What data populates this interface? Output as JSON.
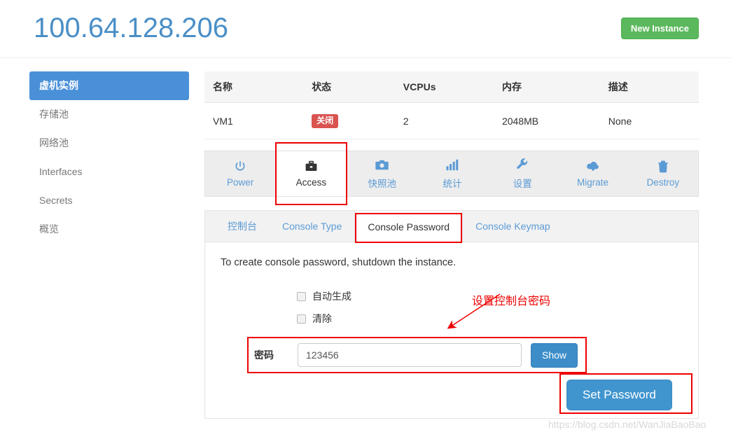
{
  "header": {
    "title": "100.64.128.206",
    "new_instance_label": "New Instance",
    "new_instance_color": "#5cb85c",
    "title_color": "#4a8fc7"
  },
  "sidebar": {
    "items": [
      {
        "label": "虚机实例",
        "active": true
      },
      {
        "label": "存储池",
        "active": false
      },
      {
        "label": "网络池",
        "active": false
      },
      {
        "label": "Interfaces",
        "active": false
      },
      {
        "label": "Secrets",
        "active": false
      },
      {
        "label": "概览",
        "active": false
      }
    ]
  },
  "instance_table": {
    "columns": [
      "名称",
      "状态",
      "VCPUs",
      "内存",
      "描述"
    ],
    "rows": [
      {
        "name": "VM1",
        "state": "关闭",
        "state_color": "#d9534f",
        "vcpus": "2",
        "memory": "2048MB",
        "description": "None"
      }
    ]
  },
  "action_bar": {
    "tabs": [
      {
        "label": "Power",
        "icon": "power-icon",
        "active": false
      },
      {
        "label": "Access",
        "icon": "briefcase-icon",
        "active": true
      },
      {
        "label": "快照池",
        "icon": "camera-icon",
        "active": false
      },
      {
        "label": "统计",
        "icon": "bar-chart-icon",
        "active": false
      },
      {
        "label": "设置",
        "icon": "wrench-icon",
        "active": false
      },
      {
        "label": "Migrate",
        "icon": "cloud-download-icon",
        "active": false
      },
      {
        "label": "Destroy",
        "icon": "trash-icon",
        "active": false
      }
    ],
    "link_color": "#5b9bd5"
  },
  "console_tabs": {
    "tabs": [
      {
        "label": "控制台",
        "active": false
      },
      {
        "label": "Console Type",
        "active": false
      },
      {
        "label": "Console Password",
        "active": true
      },
      {
        "label": "Console Keymap",
        "active": false
      }
    ]
  },
  "console_password_form": {
    "note": "To create console password, shutdown the instance.",
    "checkboxes": [
      {
        "label": "自动生成",
        "checked": false
      },
      {
        "label": "清除",
        "checked": false
      }
    ],
    "password_label": "密码",
    "password_value": "123456",
    "password_placeholder": "",
    "show_button_label": "Show",
    "set_password_label": "Set Password",
    "primary_color": "#3c8dc8"
  },
  "annotations": {
    "callout_text": "设置控制台密码",
    "callout_color": "#ee0000"
  },
  "watermark": {
    "text": "https://blog.csdn.net/WanJiaBaoBao"
  }
}
